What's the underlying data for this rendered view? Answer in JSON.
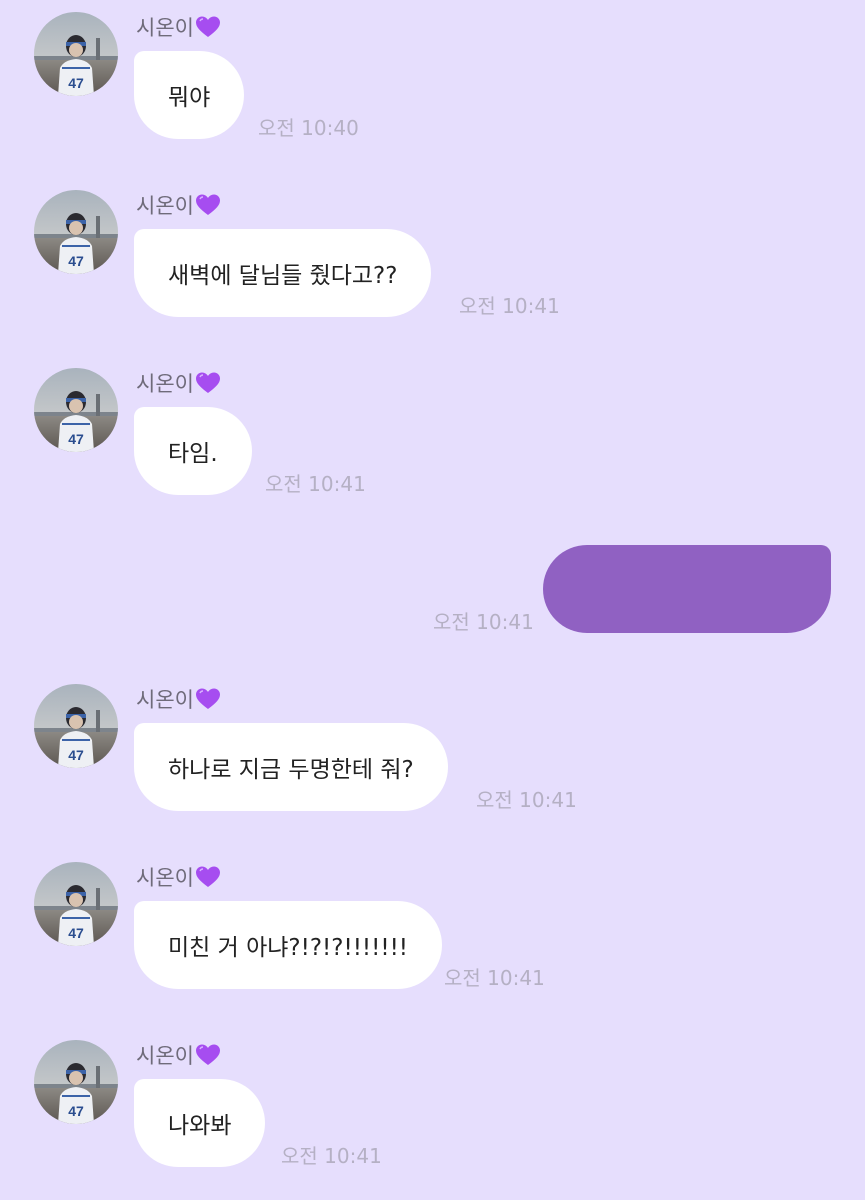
{
  "colors": {
    "background": "#e6defd",
    "incoming_bubble": "#ffffff",
    "outgoing_bubble": "#9061c2",
    "timestamp": "#b5b0c4",
    "sender_name": "#6f6b7a",
    "heart": "#a64df0"
  },
  "messages": [
    {
      "direction": "incoming",
      "sender": "시온이",
      "sender_icon": "purple-heart-icon",
      "text": "뭐야",
      "time": "오전 10:40"
    },
    {
      "direction": "incoming",
      "sender": "시온이",
      "sender_icon": "purple-heart-icon",
      "text": "새벽에 달님들 줬다고??",
      "time": "오전 10:41"
    },
    {
      "direction": "incoming",
      "sender": "시온이",
      "sender_icon": "purple-heart-icon",
      "text": "타임.",
      "time": "오전 10:41"
    },
    {
      "direction": "outgoing",
      "text": "",
      "time": "오전 10:41"
    },
    {
      "direction": "incoming",
      "sender": "시온이",
      "sender_icon": "purple-heart-icon",
      "text": "하나로 지금 두명한테 줘?",
      "time": "오전 10:41"
    },
    {
      "direction": "incoming",
      "sender": "시온이",
      "sender_icon": "purple-heart-icon",
      "text": "미친 거 아냐?!?!?!!!!!!!",
      "time": "오전 10:41"
    },
    {
      "direction": "incoming",
      "sender": "시온이",
      "sender_icon": "purple-heart-icon",
      "text": "나와봐",
      "time": "오전 10:41"
    }
  ]
}
